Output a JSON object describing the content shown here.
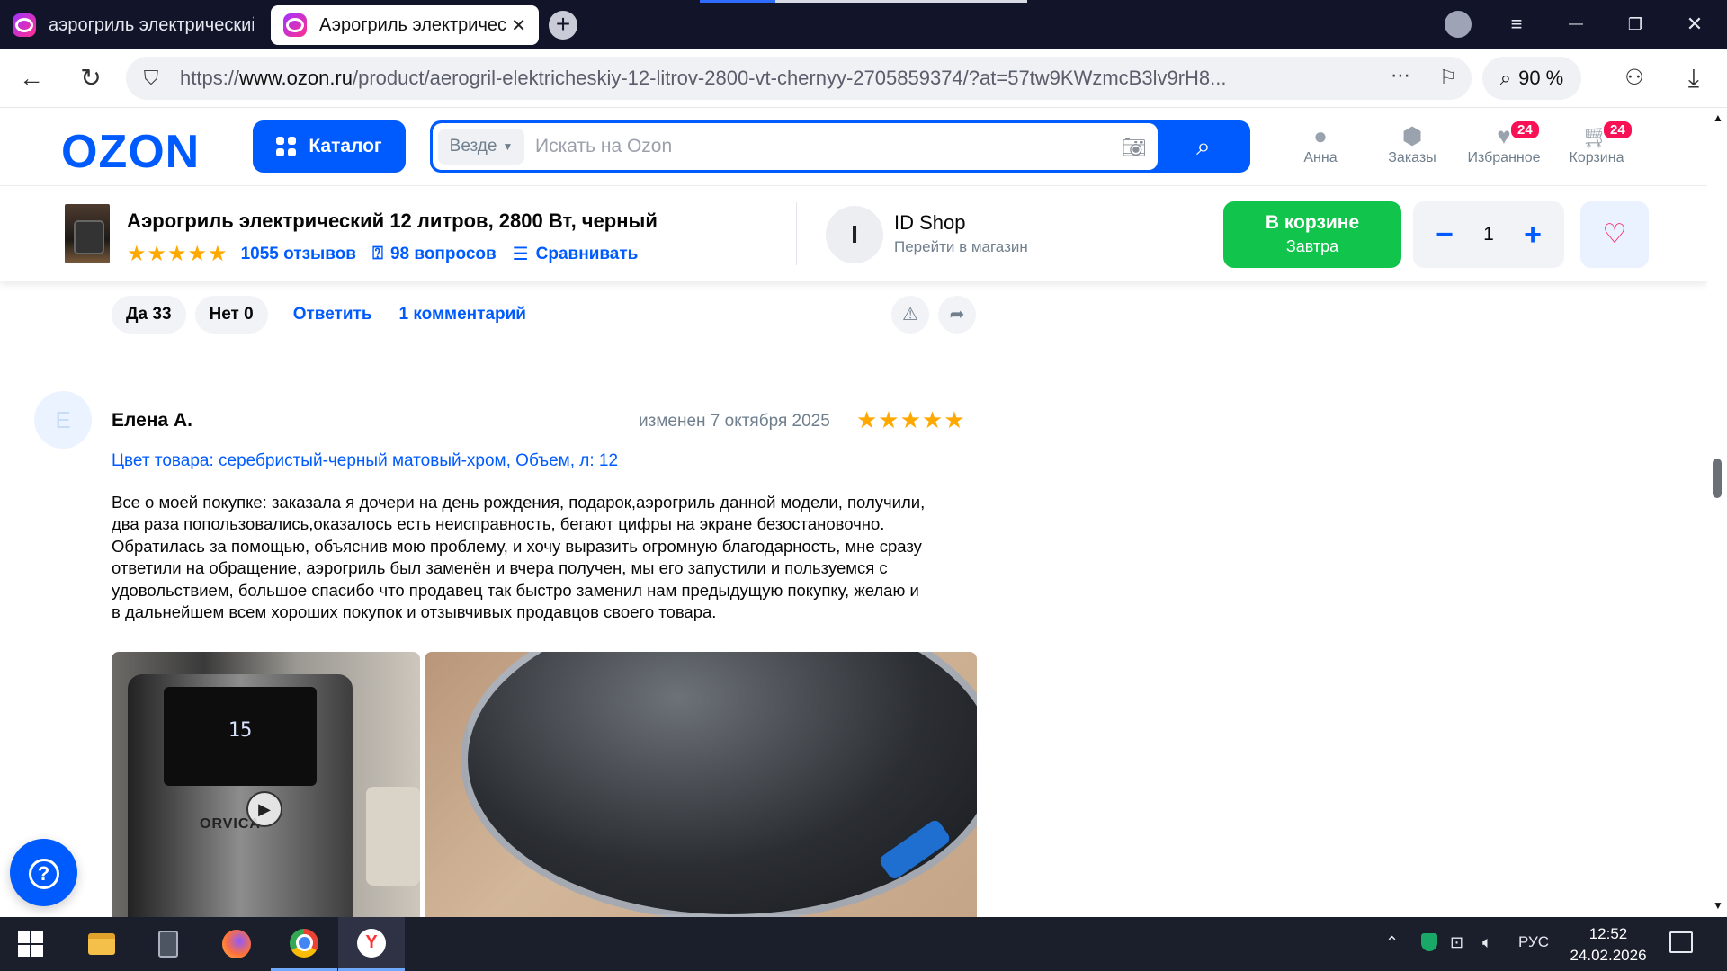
{
  "browser": {
    "tabs": [
      {
        "title": "аэрогриль электрический",
        "active": false
      },
      {
        "title": "Аэрогриль электрический",
        "active": true
      }
    ],
    "new_tab_label": "+",
    "url_prefix": "https://",
    "url_domain": "www.ozon.ru",
    "url_path": "/product/aerogril-elektricheskiy-12-litrov-2800-vt-chernyy-2705859374/?at=57tw9KWzmcB3lv9rH8...",
    "zoom": "90 %",
    "window_buttons": {
      "menu": "≡",
      "minimize": "—",
      "maximize": "❐",
      "close": "✕"
    }
  },
  "ozon": {
    "logo": "OZON",
    "catalog_label": "Каталог",
    "search_scope": "Везде",
    "search_placeholder": "Искать на Ozon",
    "header_items": [
      {
        "label": "Анна",
        "icon": "user-icon"
      },
      {
        "label": "Заказы",
        "icon": "box-icon"
      },
      {
        "label": "Избранное",
        "icon": "heart-icon",
        "badge": "24"
      },
      {
        "label": "Корзина",
        "icon": "cart-icon",
        "badge": "24"
      }
    ]
  },
  "product": {
    "title": "Аэрогриль электрический 12 литров, 2800 Вт, черный",
    "stars": "★★★★★",
    "reviews": "1055 отзывов",
    "questions": "98 вопросов",
    "compare": "Сравнивать",
    "shop_initial": "I",
    "shop_name": "ID Shop",
    "shop_link": "Перейти в магазин",
    "cart_label": "В корзине",
    "cart_sub": "Завтра",
    "quantity": "1"
  },
  "prev_review_actions": {
    "yes": "Да 33",
    "no": "Нет 0",
    "reply": "Ответить",
    "comments": "1 комментарий"
  },
  "review": {
    "avatar_letter": "Е",
    "author": "Елена А.",
    "date": "изменен 7 октября 2025",
    "rating": 5,
    "stars": "★★★★★",
    "variant": "Цвет товара: серебристый-черный матовый-хром, Объем, л: 12",
    "text_lines": [
      "Все о моей покупке: заказала я дочери на день рождения, подарок,аэрогриль данной модели, получили,",
      "два раза попользовались,оказалось есть неисправность, бегают цифры на экране безостановочно.",
      "Обратилась за помощью, объяснив мою проблему, и хочу выразить огромную благодарность, мне сразу",
      "ответили на обращение, аэрогриль был заменён и вчера получен, мы его запустили и пользуемся с",
      "удовольствием, большое спасибо что продавец так быстро заменил нам предыдущую покупку, желаю и",
      "в дальнейшем всем хороших покупок и отзывчивых продавцов своего товара."
    ],
    "photo1_display": "15",
    "photo1_brand": "ORVICA"
  },
  "taskbar": {
    "lang": "РУС",
    "time": "12:52",
    "date": "24.02.2026"
  }
}
